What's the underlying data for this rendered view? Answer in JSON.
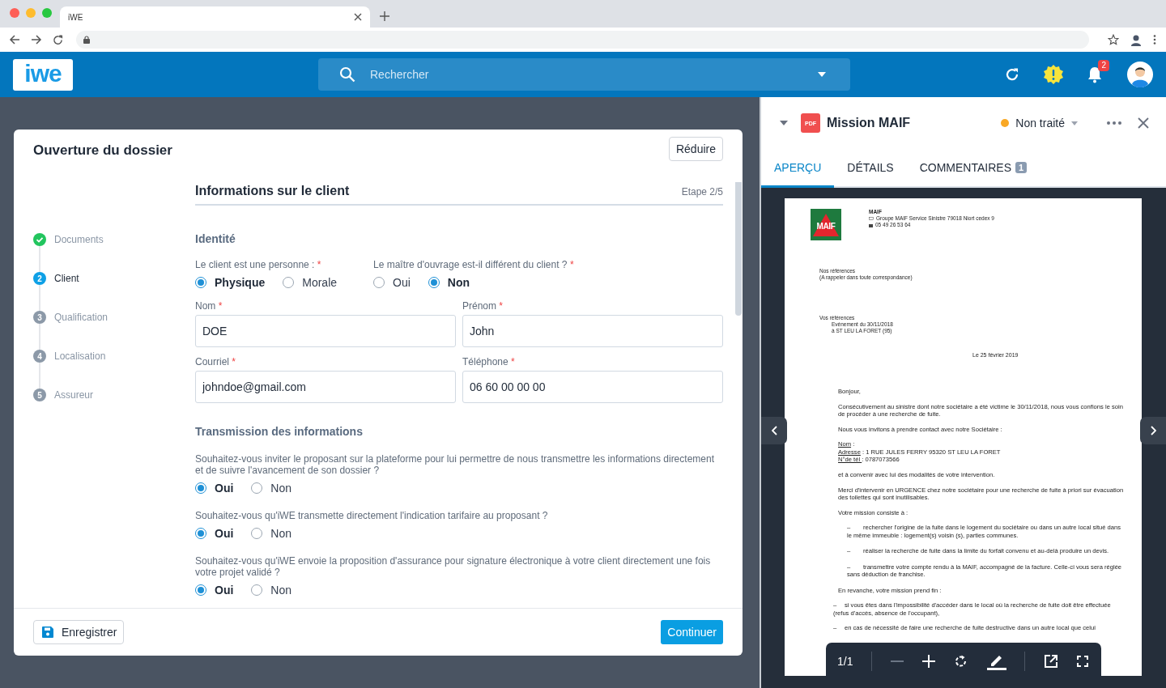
{
  "browser": {
    "tab_title": "iWE"
  },
  "header": {
    "logo": "iwe",
    "search_placeholder": "Rechercher",
    "notification_count": "2"
  },
  "modal": {
    "title": "Ouverture du dossier",
    "reduce_button": "Réduire",
    "steps": [
      {
        "label": "Documents",
        "completed": true,
        "current": false
      },
      {
        "number": "2",
        "label": "Client",
        "completed": false,
        "current": true
      },
      {
        "number": "3",
        "label": "Qualification",
        "completed": false,
        "current": false
      },
      {
        "number": "4",
        "label": "Localisation",
        "completed": false,
        "current": false
      },
      {
        "number": "5",
        "label": "Assureur",
        "completed": false,
        "current": false
      }
    ],
    "section_title": "Informations sur le client",
    "step_indicator": "Etape 2/5",
    "identity_title": "Identité",
    "identity_questions": [
      {
        "label": "Le client est une personne :",
        "mark": "*",
        "options": [
          {
            "label": "Physique",
            "selected": true
          },
          {
            "label": "Morale",
            "selected": false
          }
        ]
      },
      {
        "label": "Le maître d'ouvrage est-il différent du client ?",
        "mark": "*",
        "options": [
          {
            "label": "Oui",
            "selected": false
          },
          {
            "label": "Non",
            "selected": true
          }
        ]
      }
    ],
    "fields": [
      {
        "label": "Nom",
        "mark": "*",
        "value": "DOE"
      },
      {
        "label": "Prénom",
        "mark": "*",
        "value": "John"
      },
      {
        "label": "Courriel",
        "mark": "*",
        "value": "johndoe@gmail.com"
      },
      {
        "label": "Téléphone",
        "mark": "*",
        "value": "06 60 00 00 00"
      }
    ],
    "transmission_title": "Transmission des informations",
    "transmission_questions": [
      {
        "label": "Souhaitez-vous inviter le proposant sur la plateforme pour lui permettre de nous transmettre les informations directement et de suivre l'avancement de son dossier ?",
        "options": [
          {
            "label": "Oui",
            "selected": true
          },
          {
            "label": "Non",
            "selected": false
          }
        ]
      },
      {
        "label": "Souhaitez-vous qu'iWE transmette directement l'indication tarifaire au proposant ?",
        "options": [
          {
            "label": "Oui",
            "selected": true
          },
          {
            "label": "Non",
            "selected": false
          }
        ]
      },
      {
        "label": "Souhaitez-vous qu'iWE envoie la proposition d'assurance pour signature électronique à votre client directement une fois votre projet validé ?",
        "options": [
          {
            "label": "Oui",
            "selected": true
          },
          {
            "label": "Non",
            "selected": false
          }
        ]
      }
    ],
    "save_button": "Enregistrer",
    "continue_button": "Continuer"
  },
  "document": {
    "file_type": "PDF",
    "title": "Mission MAIF",
    "status": {
      "label": "Non traité",
      "color": "#f9a825"
    },
    "tabs": [
      {
        "label": "APERÇU",
        "selected": true
      },
      {
        "label": "DÉTAILS",
        "selected": false
      },
      {
        "label": "COMMENTAIRES",
        "count": "1",
        "selected": false
      }
    ],
    "page_indicator": "1/1",
    "letter": {
      "logo_text": "MAIF",
      "sender_name": "MAIF",
      "sender_address": "Groupe MAIF Service Sinistre   79018 Niort cedex 9",
      "sender_phone": "05 49 26 53 64",
      "our_refs": [
        "Nos références",
        "(A rappeler dans toute correspondance)"
      ],
      "your_refs_title": "Vos références",
      "your_refs": [
        "Evénement du 30/11/2018",
        "à ST LEU LA FORET (95)"
      ],
      "date": "Le 25 février 2019",
      "blocks": [
        {
          "kind": "para",
          "text": "Bonjour,"
        },
        {
          "kind": "para",
          "text": "Consécutivement au sinistre dont notre sociétaire a été victime le 30/11/2018, nous vous confions le soin de procéder à une recherche de fuite."
        },
        {
          "kind": "para",
          "text": "Nous vous invitons à prendre contact avec notre Sociétaire :"
        },
        {
          "kind": "field",
          "label": "Nom",
          "value": ":"
        },
        {
          "kind": "field",
          "label": "Adresse",
          "value": ":  1 RUE JULES FERRY 95320 ST LEU LA FORET"
        },
        {
          "kind": "field",
          "label": "N°de tél ",
          "value": ":  0787073566"
        },
        {
          "kind": "para",
          "text": "et à convenir avec lui des modalités de votre intervention."
        },
        {
          "kind": "para",
          "text": "Merci d'intervenir en URGENCE chez notre sociétaire  pour une recherche de fuite à priori sur évacuation des toilettes qui sont inutilisables."
        },
        {
          "kind": "para",
          "text": "Votre mission consiste à :"
        },
        {
          "kind": "dash",
          "bullet": "–",
          "text": "rechercher l'origine de la fuite dans le logement du sociétaire ou dans un autre local situé dans le même immeuble : logement(s) voisin (s), parties communes."
        },
        {
          "kind": "dash",
          "bullet": "–",
          "text": "réaliser la recherche de fuite dans la limite du forfait convenu et au-delà produire un devis."
        },
        {
          "kind": "dash",
          "bullet": "–",
          "text": "transmettre votre compte rendu à la MAIF, accompagné de la facture. Celle-ci vous sera réglée sans déduction de franchise."
        },
        {
          "kind": "para",
          "text": "En revanche, votre mission prend fin :"
        },
        {
          "kind": "outer",
          "bullet": "–",
          "text": "si vous êtes dans l'impossibilité d'accéder dans le local où la recherche de fuite doit être effectuée (refus d'accès, absence de l'occupant),"
        },
        {
          "kind": "outer",
          "bullet": "–",
          "text": "en cas de nécessité de faire une recherche de fuite destructive dans un autre local que celui"
        }
      ]
    }
  }
}
